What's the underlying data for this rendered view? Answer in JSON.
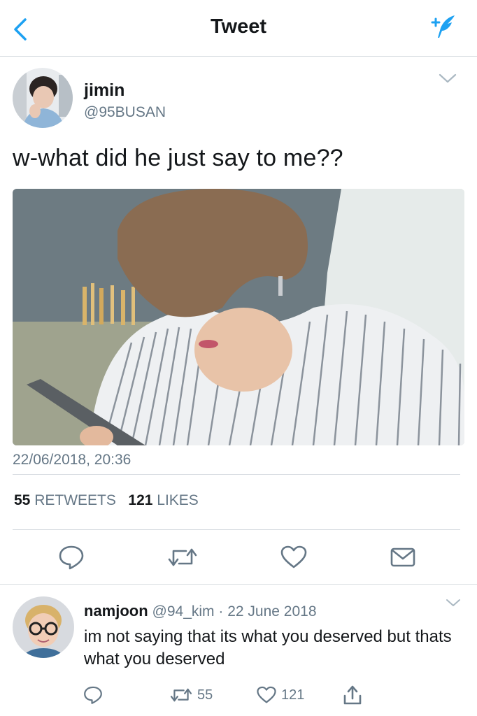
{
  "header": {
    "title": "Tweet"
  },
  "tweet": {
    "name": "jimin",
    "handle": "@95BUSAN",
    "text": "w-what did he just say to me??",
    "timestamp": "22/06/2018, 20:36",
    "retweets_count": "55",
    "retweets_label": "RETWEETS",
    "likes_count": "121",
    "likes_label": "LIKES"
  },
  "reply": {
    "name": "namjoon",
    "handle": "@94_kim",
    "separator": "·",
    "date": "22 June 2018",
    "text": "im not saying that its what you deserved but thats what you deserved",
    "retweets": "55",
    "likes": "121"
  },
  "colors": {
    "accent": "#1da1f2",
    "secondary_text": "#657786",
    "divider": "#d6dbe0"
  },
  "icons": [
    "back-chevron-icon",
    "compose-tweet-icon",
    "caret-down-icon",
    "reply-icon",
    "retweet-icon",
    "like-heart-icon",
    "direct-message-icon",
    "share-icon"
  ]
}
